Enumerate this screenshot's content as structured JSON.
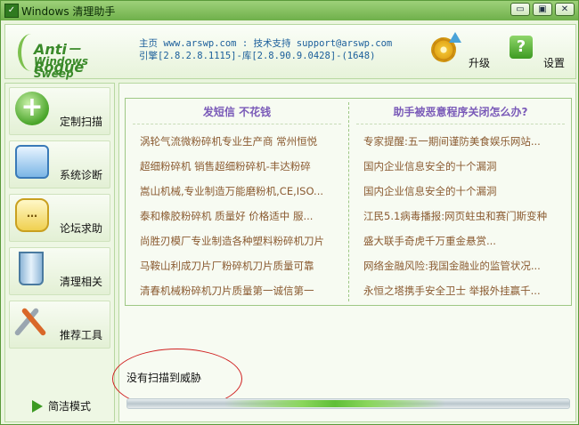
{
  "window": {
    "title": "Windows 清理助手",
    "minimize_symbol": "▭",
    "maximize_symbol": "▣",
    "close_symbol": "✕"
  },
  "header": {
    "logo_line1": "Anti－Rogue",
    "logo_line2": "Windows Sweep",
    "info_line1": "主页 www.arswp.com : 技术支持 support@arswp.com",
    "info_line2": "引擎[2.8.2.8.1115]-库[2.8.90.9.0428]-(1648)",
    "upgrade_label": "升级",
    "settings_label": "设置",
    "settings_icon_glyph": "?"
  },
  "sidebar": {
    "items": [
      {
        "label": "定制扫描",
        "icon_glyph": "+"
      },
      {
        "label": "系统诊断",
        "icon_glyph": ""
      },
      {
        "label": "论坛求助",
        "icon_glyph": "…"
      },
      {
        "label": "清理相关",
        "icon_glyph": ""
      },
      {
        "label": "推荐工具",
        "icon_glyph": ""
      }
    ],
    "simple_mode_label": "简洁模式"
  },
  "main": {
    "left_header": "发短信  不花钱",
    "right_header": "助手被恶意程序关闭怎么办?",
    "left_items": [
      "涡轮气流微粉碎机专业生产商  常州恒悦",
      "超细粉碎机 销售超细粉碎机-丰达粉碎",
      "嵩山机械,专业制造万能磨粉机,CE,ISO...",
      "泰和橡胶粉碎机 质量好 价格适中 服...",
      "尚胜刃模厂专业制造各种塑料粉碎机刀片",
      "马鞍山利成刀片厂粉碎机刀片质量可靠",
      "清春机械粉碎机刀片质量第一诚信第一"
    ],
    "right_items": [
      "专家提醒:五一期间谨防美食娱乐网站...",
      "国内企业信息安全的十个漏洞",
      "国内企业信息安全的十个漏洞",
      "江民5.1病毒播报:网页蛀虫和赛门斯变种",
      "盛大联手奇虎千万重金悬赏...",
      "网络金融风险:我国金融业的监管状况...",
      "永恒之塔携手安全卫士 举报外挂赢千..."
    ],
    "status_text": "没有扫描到威胁",
    "progress_fraction": 0.5
  },
  "colors": {
    "accent_green": "#6fb04a",
    "news_text": "#8a5a30",
    "header_text": "#7a5ab8",
    "info_text": "#1a5e9a",
    "annotation_red": "#d02020"
  }
}
